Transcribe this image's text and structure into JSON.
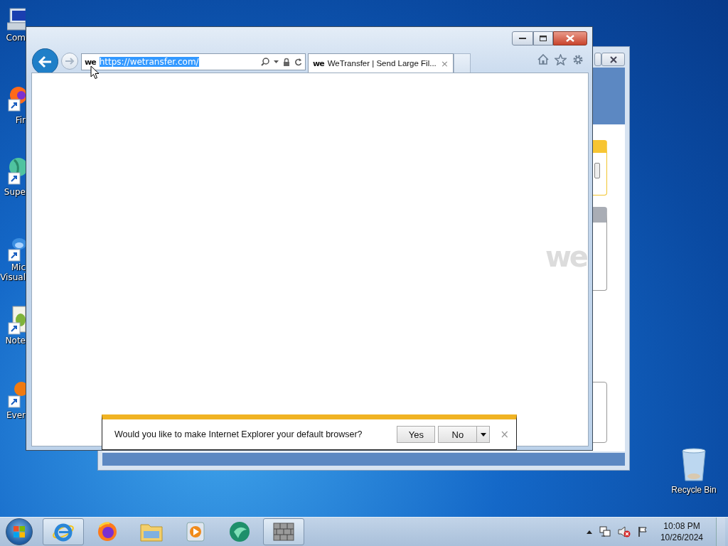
{
  "desktop_icons": [
    {
      "kind": "computer",
      "lines": [
        "Com"
      ]
    },
    {
      "kind": "firefox",
      "lines": [
        "Fir"
      ]
    },
    {
      "kind": "globe",
      "lines": [
        "Supe"
      ]
    },
    {
      "kind": "studio",
      "lines": [
        "Mic",
        "Visual"
      ]
    },
    {
      "kind": "notepad",
      "lines": [
        "Note"
      ]
    },
    {
      "kind": "everything",
      "lines": [
        "Ever"
      ]
    },
    {
      "kind": "recycle",
      "lines": [
        "Recycle Bin"
      ]
    }
  ],
  "browser": {
    "forward": {
      "disabled": true
    },
    "address": {
      "favicon": "we",
      "url": "https://wetransfer.com/",
      "selected": true
    },
    "tabs": [
      {
        "favicon": "we",
        "title": "WeTransfer | Send Large Fil...",
        "close": "×",
        "selected": true
      }
    ],
    "page": {
      "logo": "we"
    },
    "notification": {
      "message": "Would you like to make Internet Explorer your default browser?",
      "buttons": [
        {
          "label": "Yes",
          "has_menu": false
        },
        {
          "label": "No",
          "has_menu": true
        }
      ],
      "close": "×"
    }
  },
  "taskbar": {
    "items": [
      {
        "kind": "ie",
        "running": true
      },
      {
        "kind": "firefox",
        "running": false
      },
      {
        "kind": "explorer",
        "running": false
      },
      {
        "kind": "media",
        "running": false
      },
      {
        "kind": "green",
        "running": false
      },
      {
        "kind": "wall",
        "running": true
      }
    ],
    "tray": [
      {
        "kind": "chevron"
      },
      {
        "kind": "network"
      },
      {
        "kind": "volume-muted"
      },
      {
        "kind": "flag"
      }
    ],
    "time": "10:08 PM",
    "date": "10/26/2024"
  }
}
